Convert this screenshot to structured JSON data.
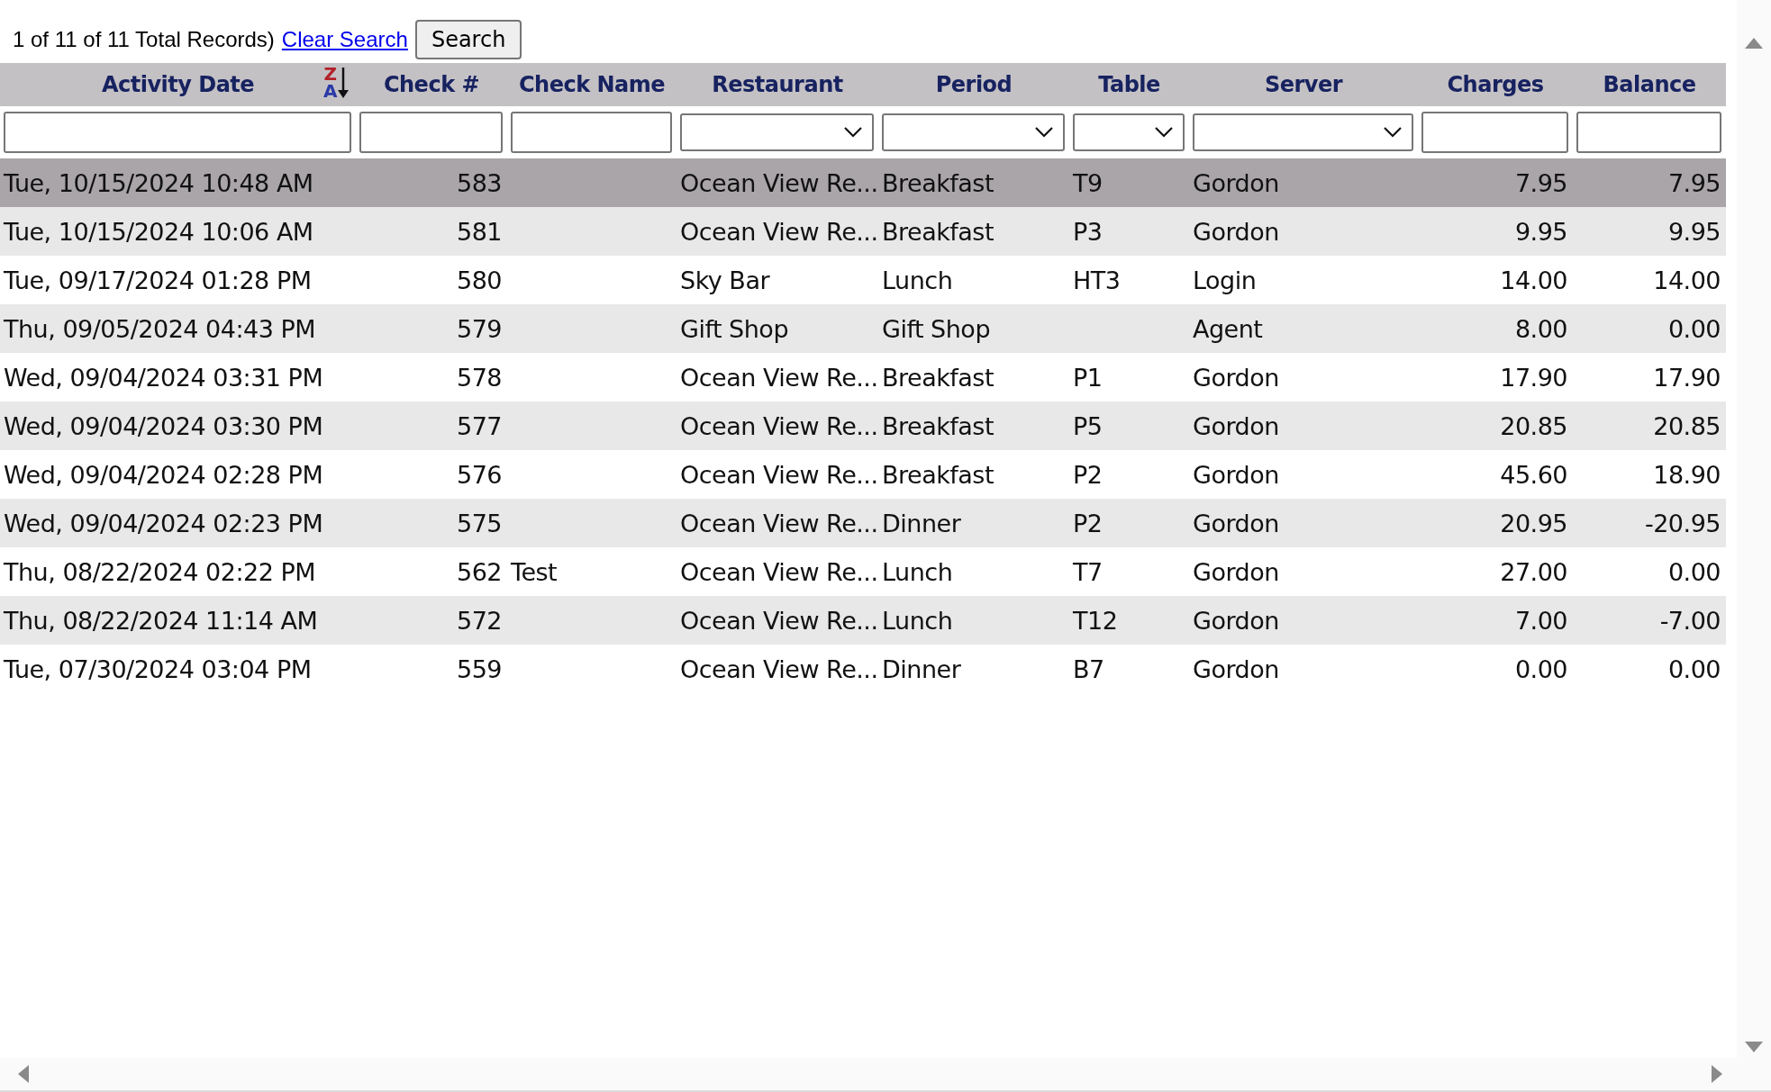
{
  "toolbar": {
    "record_count": "1 of 11 of 11 Total Records)",
    "clear_link": "Clear Search",
    "search_button": "Search"
  },
  "table": {
    "columns": [
      {
        "label": "Activity Date",
        "kind": "plain",
        "filter": {
          "kind": "text"
        },
        "sort": {
          "kind": "descending",
          "letters": [
            "Z",
            "A"
          ]
        }
      },
      {
        "label": "Check #",
        "kind": "numeric",
        "filter": {
          "kind": "text"
        }
      },
      {
        "label": "Check Name",
        "kind": "plain",
        "filter": {
          "kind": "text"
        }
      },
      {
        "label": "Restaurant",
        "kind": "plain",
        "filter": {
          "kind": "select"
        }
      },
      {
        "label": "Period",
        "kind": "plain",
        "filter": {
          "kind": "select"
        }
      },
      {
        "label": "Table",
        "kind": "plain",
        "filter": {
          "kind": "select"
        }
      },
      {
        "label": "Server",
        "kind": "plain",
        "filter": {
          "kind": "select"
        }
      },
      {
        "label": "Charges",
        "kind": "numeric",
        "filter": {
          "kind": "text"
        }
      },
      {
        "label": "Balance",
        "kind": "numeric",
        "filter": {
          "kind": "text"
        }
      }
    ],
    "rows": [
      {
        "selected": true,
        "cells": [
          "Tue, 10/15/2024 10:48 AM",
          "583",
          "",
          "Ocean View Re...",
          "Breakfast",
          "T9",
          "Gordon",
          "7.95",
          "7.95"
        ]
      },
      {
        "selected": false,
        "cells": [
          "Tue, 10/15/2024 10:06 AM",
          "581",
          "",
          "Ocean View Re...",
          "Breakfast",
          "P3",
          "Gordon",
          "9.95",
          "9.95"
        ]
      },
      {
        "selected": false,
        "cells": [
          "Tue, 09/17/2024 01:28 PM",
          "580",
          "",
          "Sky Bar",
          "Lunch",
          "HT3",
          "Login",
          "14.00",
          "14.00"
        ]
      },
      {
        "selected": false,
        "cells": [
          "Thu, 09/05/2024 04:43 PM",
          "579",
          "",
          "Gift Shop",
          "Gift Shop",
          "",
          "Agent",
          "8.00",
          "0.00"
        ]
      },
      {
        "selected": false,
        "cells": [
          "Wed, 09/04/2024 03:31 PM",
          "578",
          "",
          "Ocean View Re...",
          "Breakfast",
          "P1",
          "Gordon",
          "17.90",
          "17.90"
        ]
      },
      {
        "selected": false,
        "cells": [
          "Wed, 09/04/2024 03:30 PM",
          "577",
          "",
          "Ocean View Re...",
          "Breakfast",
          "P5",
          "Gordon",
          "20.85",
          "20.85"
        ]
      },
      {
        "selected": false,
        "cells": [
          "Wed, 09/04/2024 02:28 PM",
          "576",
          "",
          "Ocean View Re...",
          "Breakfast",
          "P2",
          "Gordon",
          "45.60",
          "18.90"
        ]
      },
      {
        "selected": false,
        "cells": [
          "Wed, 09/04/2024 02:23 PM",
          "575",
          "",
          "Ocean View Re...",
          "Dinner",
          "P2",
          "Gordon",
          "20.95",
          "-20.95"
        ]
      },
      {
        "selected": false,
        "cells": [
          "Thu, 08/22/2024 02:22 PM",
          "562",
          "Test",
          "Ocean View Re...",
          "Lunch",
          "T7",
          "Gordon",
          "27.00",
          "0.00"
        ]
      },
      {
        "selected": false,
        "cells": [
          "Thu, 08/22/2024 11:14 AM",
          "572",
          "",
          "Ocean View Re...",
          "Lunch",
          "T12",
          "Gordon",
          "7.00",
          "-7.00"
        ]
      },
      {
        "selected": false,
        "cells": [
          "Tue, 07/30/2024 03:04 PM",
          "559",
          "",
          "Ocean View Re...",
          "Dinner",
          "B7",
          "Gordon",
          "0.00",
          "0.00"
        ]
      }
    ]
  }
}
